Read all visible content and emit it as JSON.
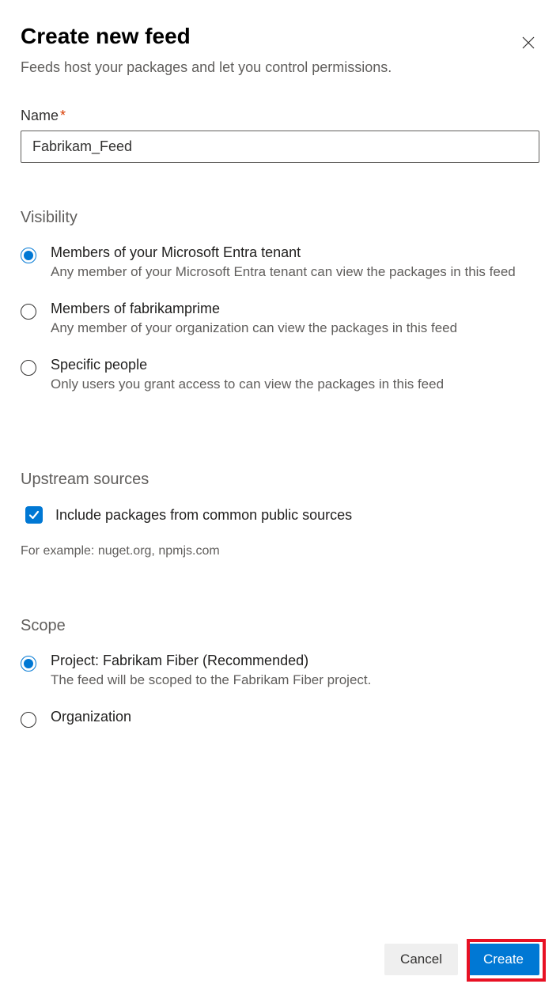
{
  "header": {
    "title": "Create new feed",
    "subtitle": "Feeds host your packages and let you control permissions."
  },
  "name": {
    "label": "Name",
    "value": "Fabrikam_Feed"
  },
  "visibility": {
    "section_title": "Visibility",
    "options": [
      {
        "title": "Members of your Microsoft Entra tenant",
        "desc": "Any member of your Microsoft Entra tenant can view the packages in this feed"
      },
      {
        "title": "Members of fabrikamprime",
        "desc": "Any member of your organization can view the packages in this feed"
      },
      {
        "title": "Specific people",
        "desc": "Only users you grant access to can view the packages in this feed"
      }
    ]
  },
  "upstream": {
    "section_title": "Upstream sources",
    "checkbox_label": "Include packages from common public sources",
    "helper_text": "For example: nuget.org, npmjs.com"
  },
  "scope": {
    "section_title": "Scope",
    "options": [
      {
        "title": "Project: Fabrikam Fiber (Recommended)",
        "desc": "The feed will be scoped to the Fabrikam Fiber project."
      },
      {
        "title": "Organization",
        "desc": ""
      }
    ]
  },
  "footer": {
    "cancel": "Cancel",
    "create": "Create"
  }
}
